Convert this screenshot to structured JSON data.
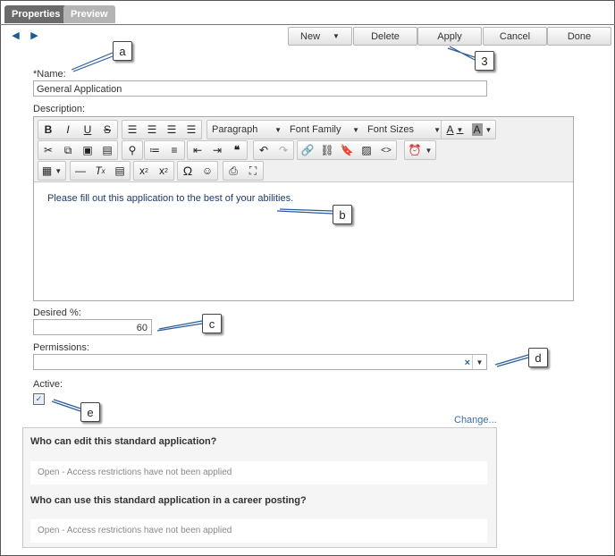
{
  "tabs": [
    {
      "label": "Properties",
      "active": true
    },
    {
      "label": "Preview",
      "active": false
    }
  ],
  "toolbar": {
    "new_label": "New",
    "delete_label": "Delete",
    "apply_label": "Apply",
    "cancel_label": "Cancel",
    "done_label": "Done"
  },
  "form": {
    "name_label": "*Name:",
    "name_value": "General Application",
    "description_label": "Description:",
    "description_text": "Please fill out this application to the best of your abilities.",
    "desired_label": "Desired %:",
    "desired_value": "60",
    "permissions_label": "Permissions:",
    "permissions_value": "",
    "active_label": "Active:",
    "active_checked": true
  },
  "editor": {
    "paragraph": "Paragraph",
    "font_family": "Font Family",
    "font_sizes": "Font Sizes"
  },
  "change_link": "Change...",
  "access": {
    "edit_question": "Who can edit this standard application?",
    "edit_status": "Open - Access restrictions have not been applied",
    "use_question": "Who can use this standard application in a career posting?",
    "use_status": "Open - Access restrictions have not been applied"
  },
  "callouts": {
    "a": "a",
    "b": "b",
    "c": "c",
    "d": "d",
    "e": "e",
    "three": "3"
  }
}
